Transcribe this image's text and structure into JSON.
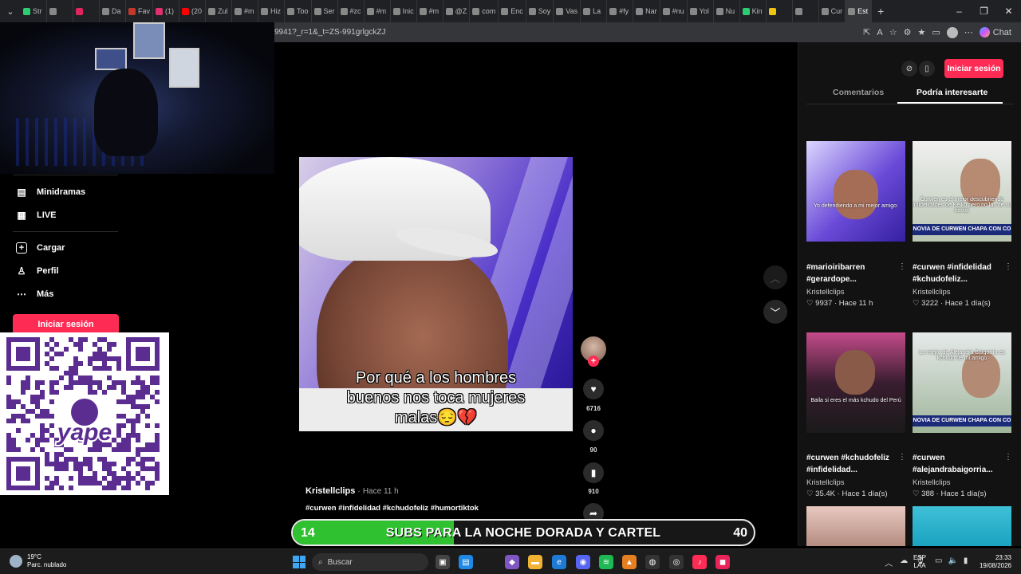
{
  "browser": {
    "tabs": [
      {
        "label": "Str",
        "color": "#2ecc71"
      },
      {
        "label": "",
        "color": "#888"
      },
      {
        "label": "",
        "color": "#e0245e"
      },
      {
        "label": "Da",
        "color": "#888"
      },
      {
        "label": "Fav",
        "color": "#c0392b"
      },
      {
        "label": "(1)",
        "color": "#e1306c"
      },
      {
        "label": "(20",
        "color": "#ff0000"
      },
      {
        "label": "Zul",
        "color": "#888"
      },
      {
        "label": "#m",
        "color": "#888"
      },
      {
        "label": "Hiz",
        "color": "#888"
      },
      {
        "label": "Too",
        "color": "#888"
      },
      {
        "label": "Ser",
        "color": "#888"
      },
      {
        "label": "#zc",
        "color": "#888"
      },
      {
        "label": "#m",
        "color": "#888"
      },
      {
        "label": "Inic",
        "color": "#888"
      },
      {
        "label": "#m",
        "color": "#888"
      },
      {
        "label": "@Z",
        "color": "#888"
      },
      {
        "label": "com",
        "color": "#888"
      },
      {
        "label": "Enc",
        "color": "#888"
      },
      {
        "label": "Soy",
        "color": "#888"
      },
      {
        "label": "Vas",
        "color": "#888"
      },
      {
        "label": "La",
        "color": "#888"
      },
      {
        "label": "#fy",
        "color": "#888"
      },
      {
        "label": "Nar",
        "color": "#888"
      },
      {
        "label": "#nu",
        "color": "#888"
      },
      {
        "label": "Yol",
        "color": "#888"
      },
      {
        "label": "Nu",
        "color": "#888"
      },
      {
        "label": "Kin",
        "color": "#2ecc71"
      },
      {
        "label": "",
        "color": "#f1c40f"
      },
      {
        "label": "",
        "color": "#888"
      },
      {
        "label": "Cur",
        "color": "#888"
      },
      {
        "label": "Est",
        "color": "#888",
        "active": true
      }
    ],
    "url": "9941?_r=1&_t=ZS-991grlgckZJ",
    "chat_label": "Chat"
  },
  "leftnav": {
    "items": [
      {
        "label": "Minidramas",
        "icon": "film-icon"
      },
      {
        "label": "LIVE",
        "icon": "live-icon"
      },
      {
        "label": "Cargar",
        "icon": "upload-icon"
      },
      {
        "label": "Perfil",
        "icon": "profile-icon"
      },
      {
        "label": "Más",
        "icon": "more-icon"
      }
    ],
    "login": "Iniciar sesión"
  },
  "qr": {
    "brand": "yape",
    "color": "#5c2d91"
  },
  "video": {
    "caption_lines": [
      "Por qué a los hombres",
      "buenos nos toca mujeres",
      "malas😔💔"
    ],
    "author": "Kristellclips",
    "time": "Hace 11 h",
    "hashtags": "#curwen #infidelidad #kchudofeliz #humortiktok",
    "likes": "6716",
    "comments": "90",
    "saves": "910"
  },
  "rightpanel": {
    "login": "Iniciar sesión",
    "tabs": [
      "Comentarios",
      "Podría interesarte"
    ],
    "cards": [
      {
        "title": "#marioiribarren #gerardope...",
        "author": "Kristellclips",
        "views": "9937",
        "time": "Hace 11 h",
        "caption": "Yo defendiendo a mi mejor amigo:",
        "banner": ""
      },
      {
        "title": "#curwen #infidelidad #kchudofeliz...",
        "author": "Kristellclips",
        "views": "3222",
        "time": "Hace 1 día(s)",
        "caption": "Curwen es el mejor descubriendo infidelidades de Keiko pero no las de su novia:",
        "banner": "NOVIA DE CURWEN CHAPA CON CO"
      },
      {
        "title": "#curwen #kchudofeliz #infidelidad...",
        "author": "Kristellclips",
        "views": "35.4K",
        "time": "Hace 1 día(s)",
        "caption": "Baila si eres el más kchudo del Perú",
        "banner": ""
      },
      {
        "title": "#curwen #alejandrabaigorria...",
        "author": "Kristellclips",
        "views": "388",
        "time": "Hace 1 día(s)",
        "caption": "Lo mejor de Alejandra Baigorria es kchudo de mi amigo",
        "banner": "NOVIA DE CURWEN CHAPA CON CO"
      }
    ]
  },
  "goal": {
    "current": "14",
    "target": "40",
    "text": "SUBS PARA LA NOCHE DORADA Y CARTEL",
    "progress": 0.35
  },
  "taskbar": {
    "temp": "19°C",
    "weather": "Parc. nublado",
    "search": "Buscar",
    "lang1": "ESP",
    "lang2": "LAA",
    "time": "23:33",
    "date": "19/08/2026"
  }
}
